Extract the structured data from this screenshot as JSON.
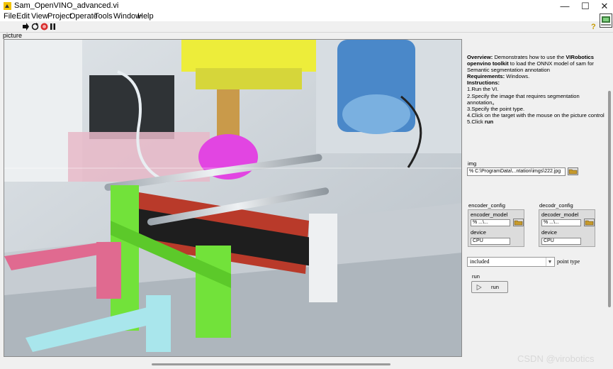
{
  "window": {
    "title": "Sam_OpenVINO_advanced.vi",
    "minimize": "—",
    "maximize": "☐",
    "close": "✕"
  },
  "menu": [
    "File",
    "Edit",
    "View",
    "Project",
    "Operate",
    "Tools",
    "Window",
    "Help"
  ],
  "toolbar": {
    "icons": [
      "run-arrow-icon",
      "run-continuously-icon",
      "abort-icon",
      "pause-icon"
    ],
    "help": "?"
  },
  "picture": {
    "label": "picture"
  },
  "description": {
    "overview_heading": "Overview:",
    "overview_text_1": "Demonstrates how to use the",
    "brand": "VIRobotics openvino toolkit",
    "overview_text_2": "to load the ONNX model of sam for Semantic segmentation annotation",
    "requirements_heading": "Requirements:",
    "requirements_text": "Windows.",
    "instructions_heading": "Instructions:",
    "steps": [
      "1.Run the VI.",
      "2.Specify the image that requires segmentation annotation。",
      "3.Specify the point type.",
      "4.Click on the target with the mouse on the picture control"
    ],
    "step5_prefix": "5.Click",
    "step5_run": "run"
  },
  "img": {
    "label": "img",
    "path": "C:\\ProgramData\\...ntation\\imgs\\222.jpg"
  },
  "encoder_config": {
    "label": "encoder_config",
    "model_label": "encoder_model",
    "model_value": "...\\...",
    "device_label": "device",
    "device_value": "CPU"
  },
  "decoder_config": {
    "label": "decodr_config",
    "model_label": "decoder_model",
    "model_value": "...\\...",
    "device_label": "device",
    "device_value": "CPU"
  },
  "point_type": {
    "label": "point type",
    "value": "included"
  },
  "run": {
    "label": "run",
    "button": "run"
  },
  "watermark": "CSDN @virobotics",
  "colors": {
    "accent_yellow": "#f2c200",
    "abort_red": "#d92c2c",
    "run_green": "#2d8f2d"
  }
}
